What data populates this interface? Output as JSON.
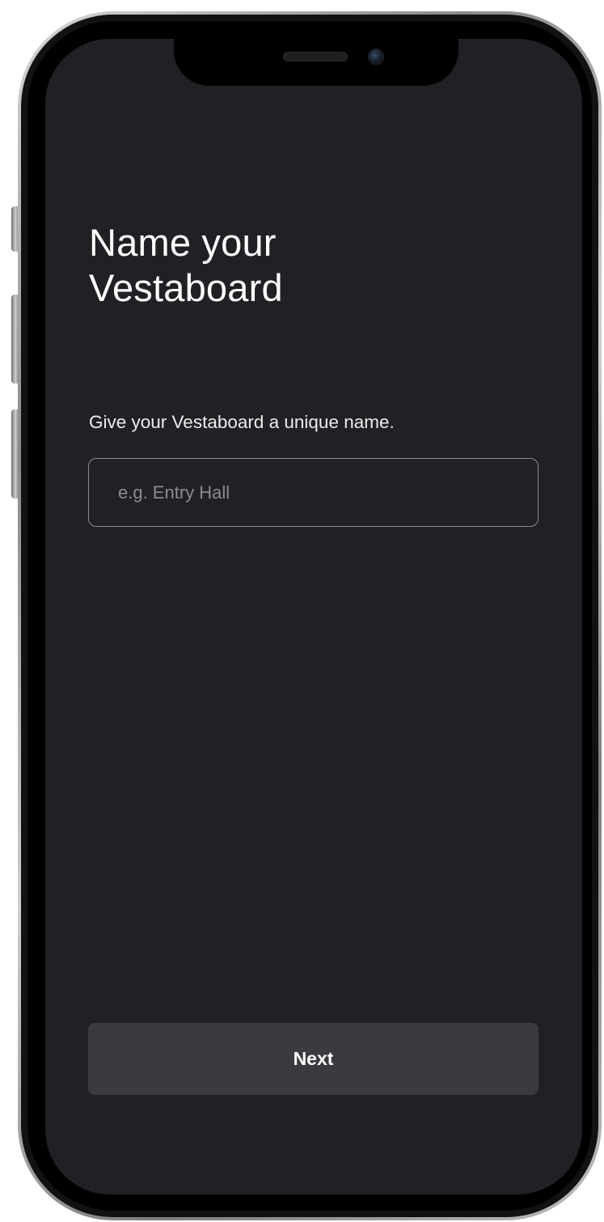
{
  "title": {
    "line1": "Name your",
    "line2": "Vestaboard"
  },
  "subtitle": "Give your Vestaboard a unique name.",
  "name_input": {
    "value": "",
    "placeholder": "e.g. Entry Hall"
  },
  "next_button": {
    "label": "Next"
  },
  "colors": {
    "screen_background": "#202124",
    "button_background": "#393b3f",
    "input_border": "#8a8c90",
    "text": "#ffffff"
  }
}
